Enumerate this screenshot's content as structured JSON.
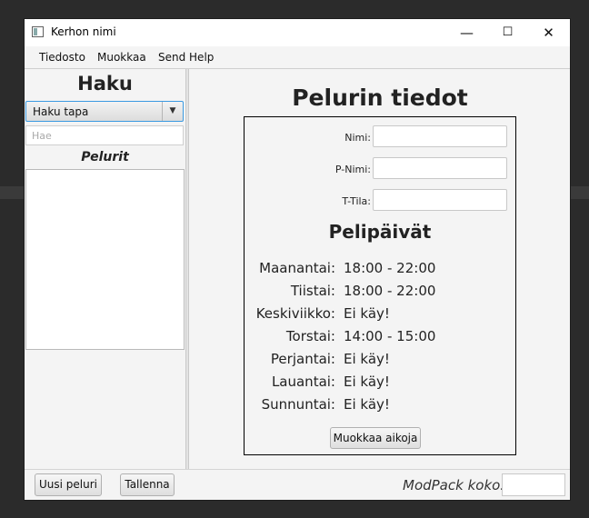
{
  "window": {
    "title": "Kerhon nimi",
    "minimize": "—",
    "maximize": "☐",
    "close": "✕"
  },
  "menu": {
    "items": [
      "Tiedosto",
      "Muokkaa",
      "Send Help"
    ]
  },
  "left": {
    "title": "Haku",
    "combo_value": "Haku tapa",
    "combo_arrow": "▼",
    "search_placeholder": "Hae",
    "list_title": "Pelurit"
  },
  "right": {
    "title": "Pelurin tiedot",
    "fields": [
      {
        "label": "Nimi:",
        "value": ""
      },
      {
        "label": "P-Nimi:",
        "value": ""
      },
      {
        "label": "T-Tila:",
        "value": ""
      }
    ],
    "days_title": "Pelipäivät",
    "days": [
      {
        "day": "Maanantai:",
        "time": "18:00 - 22:00"
      },
      {
        "day": "Tiistai:",
        "time": "18:00 - 22:00"
      },
      {
        "day": "Keskiviikko:",
        "time": "Ei käy!"
      },
      {
        "day": "Torstai:",
        "time": "14:00 - 15:00"
      },
      {
        "day": "Perjantai:",
        "time": "Ei käy!"
      },
      {
        "day": "Lauantai:",
        "time": "Ei käy!"
      },
      {
        "day": "Sunnuntai:",
        "time": "Ei käy!"
      }
    ],
    "edit_button": "Muokkaa aikoja"
  },
  "bottom": {
    "new_button": "Uusi peluri",
    "save_button": "Tallenna",
    "modpack_label": "ModPack koko:",
    "modpack_value": ""
  }
}
